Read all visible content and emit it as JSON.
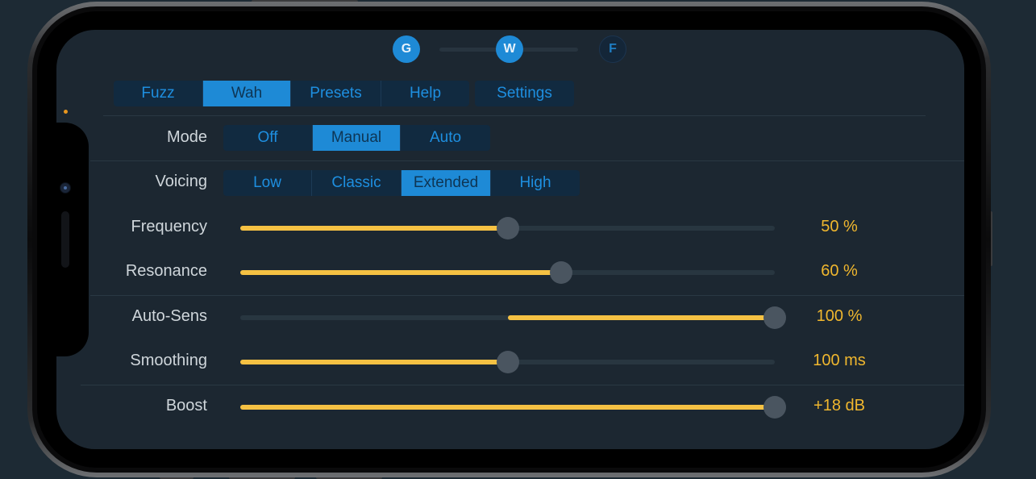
{
  "colors": {
    "accent": "#1e8ad6",
    "slider_fill": "#f5c143",
    "value_text": "#f0b72e",
    "background": "#1c2731"
  },
  "nav_dots": [
    {
      "label": "G",
      "active": true
    },
    {
      "label": "W",
      "active": true
    },
    {
      "label": "F",
      "active": false
    }
  ],
  "tabs": {
    "items": [
      "Fuzz",
      "Wah",
      "Presets",
      "Help"
    ],
    "selected": "Wah",
    "settings_label": "Settings"
  },
  "mode": {
    "label": "Mode",
    "options": [
      "Off",
      "Manual",
      "Auto"
    ],
    "selected": "Manual"
  },
  "voicing": {
    "label": "Voicing",
    "options": [
      "Low",
      "Classic",
      "Extended",
      "High"
    ],
    "selected": "Extended"
  },
  "sliders": [
    {
      "label": "Frequency",
      "value_text": "50 %",
      "fill_from": 0,
      "fill_to": 0.5,
      "thumb": 0.5
    },
    {
      "label": "Resonance",
      "value_text": "60 %",
      "fill_from": 0,
      "fill_to": 0.6,
      "thumb": 0.6
    },
    {
      "label": "Auto-Sens",
      "value_text": "100 %",
      "fill_from": 0.5,
      "fill_to": 1.0,
      "thumb": 1.0
    },
    {
      "label": "Smoothing",
      "value_text": "100 ms",
      "fill_from": 0,
      "fill_to": 0.5,
      "thumb": 0.5
    },
    {
      "label": "Boost",
      "value_text": "+18 dB",
      "fill_from": 0,
      "fill_to": 1.0,
      "thumb": 1.0
    }
  ]
}
